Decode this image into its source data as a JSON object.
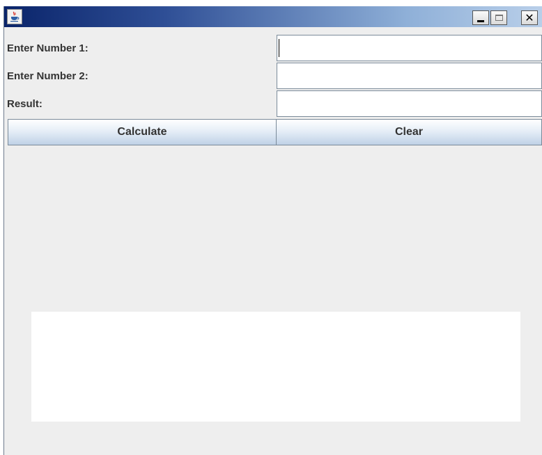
{
  "window": {
    "title": "",
    "titlebar_gradient": [
      "#0a246a",
      "#b9cfe9"
    ],
    "controls": {
      "minimize": "_",
      "maximize": "□",
      "close": "✕"
    }
  },
  "form": {
    "number1": {
      "label": "Enter Number 1:",
      "value": ""
    },
    "number2": {
      "label": "Enter Number 2:",
      "value": ""
    },
    "result": {
      "label": "Result:",
      "value": ""
    }
  },
  "buttons": {
    "calculate": "Calculate",
    "clear": "Clear"
  },
  "colors": {
    "background": "#eeeeee",
    "field_border": "#7a8a99",
    "text": "#333333"
  },
  "icons": {
    "app": "java-coffee-cup-icon"
  }
}
